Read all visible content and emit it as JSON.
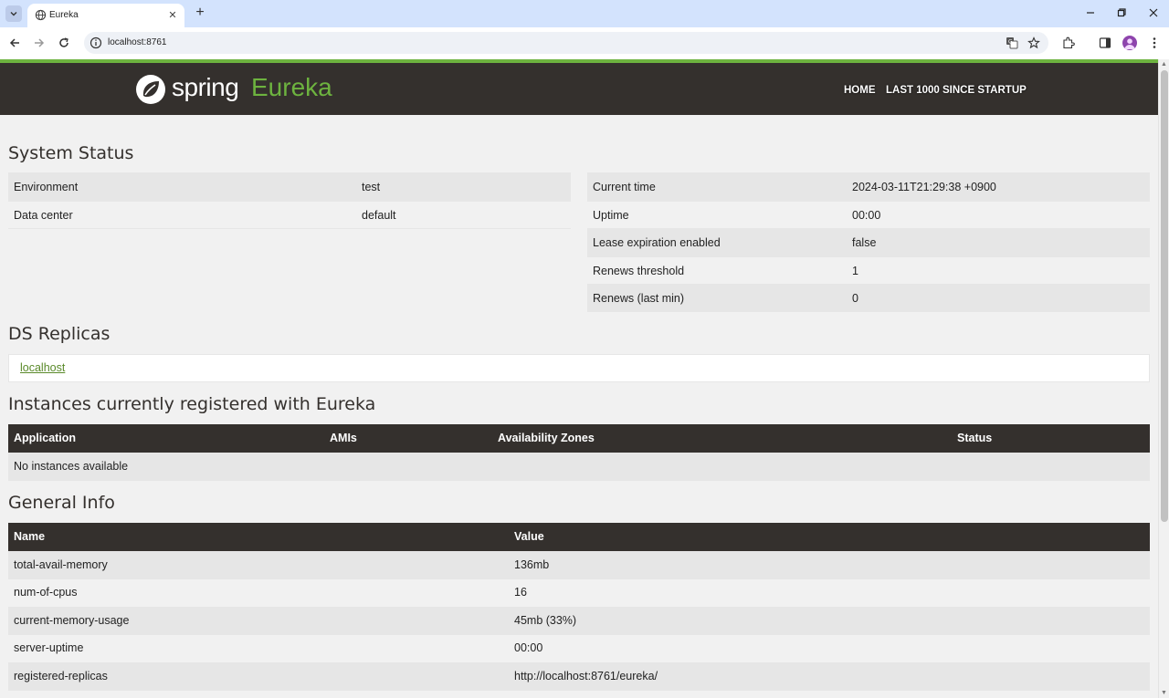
{
  "browser": {
    "tab_title": "Eureka",
    "url": "localhost:8761"
  },
  "header": {
    "logo_spring": "spring",
    "logo_eureka": "Eureka",
    "nav": [
      "HOME",
      "LAST 1000 SINCE STARTUP"
    ]
  },
  "system_status": {
    "title": "System Status",
    "left": [
      {
        "label": "Environment",
        "value": "test"
      },
      {
        "label": "Data center",
        "value": "default"
      }
    ],
    "right": [
      {
        "label": "Current time",
        "value": "2024-03-11T21:29:38 +0900"
      },
      {
        "label": "Uptime",
        "value": "00:00"
      },
      {
        "label": "Lease expiration enabled",
        "value": "false"
      },
      {
        "label": "Renews threshold",
        "value": "1"
      },
      {
        "label": "Renews (last min)",
        "value": "0"
      }
    ]
  },
  "ds_replicas": {
    "title": "DS Replicas",
    "link": "localhost"
  },
  "instances": {
    "title": "Instances currently registered with Eureka",
    "columns": [
      "Application",
      "AMIs",
      "Availability Zones",
      "Status"
    ],
    "empty_text": "No instances available"
  },
  "general_info": {
    "title": "General Info",
    "columns": [
      "Name",
      "Value"
    ],
    "rows": [
      {
        "name": "total-avail-memory",
        "value": "136mb"
      },
      {
        "name": "num-of-cpus",
        "value": "16"
      },
      {
        "name": "current-memory-usage",
        "value": "45mb (33%)"
      },
      {
        "name": "server-uptime",
        "value": "00:00"
      },
      {
        "name": "registered-replicas",
        "value": "http://localhost:8761/eureka/"
      }
    ]
  },
  "colors": {
    "brand_green": "#6db33f",
    "header_dark": "#34302d"
  }
}
